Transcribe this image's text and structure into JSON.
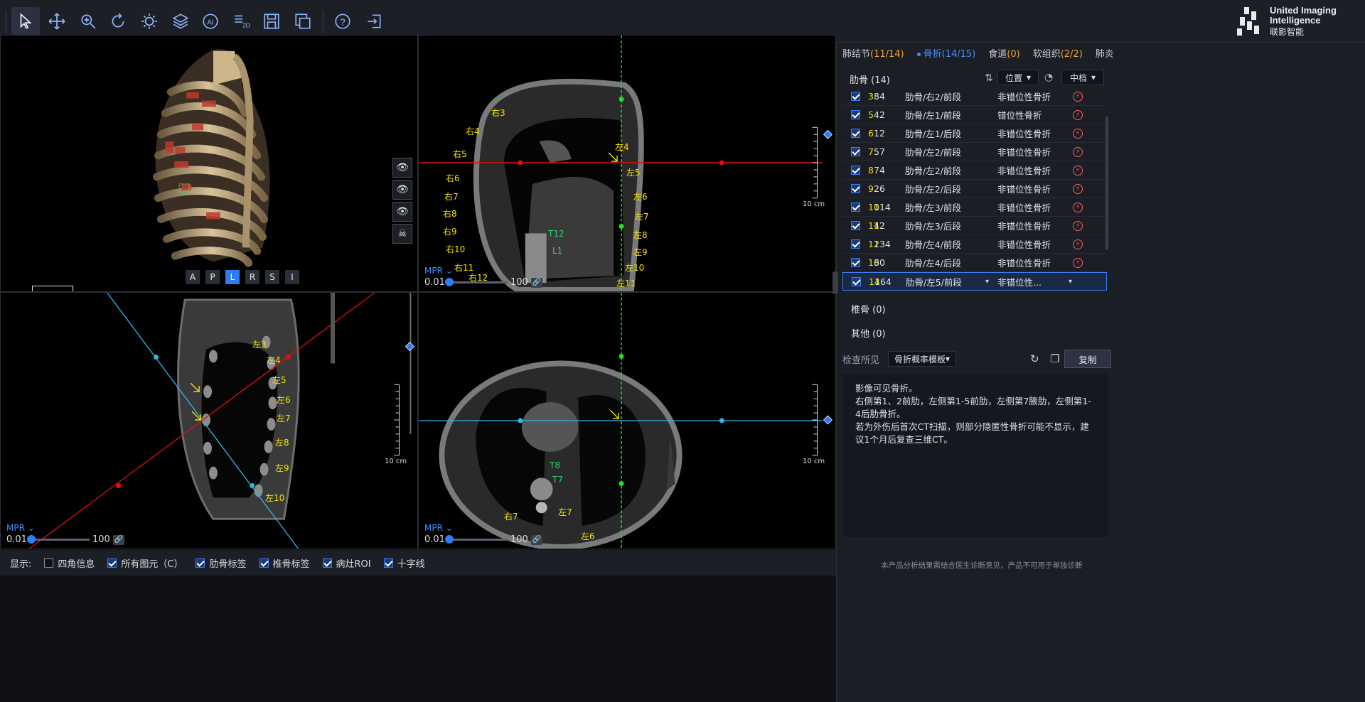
{
  "toolbar": {
    "tools": [
      "select",
      "pan",
      "zoom",
      "rotate",
      "window-level",
      "layers",
      "ai",
      "2d",
      "save",
      "export",
      "help",
      "exit"
    ],
    "brand_en_line1": "United Imaging",
    "brand_en_line2": "Intelligence",
    "brand_cn": "联影智能"
  },
  "viewports": {
    "volume": {
      "orientation_badge": "L",
      "orient_buttons": [
        "A",
        "P",
        "L",
        "R",
        "S",
        "I"
      ],
      "selected_orient": "L"
    },
    "coronal": {
      "mpr_label": "MPR",
      "slider_min": "0.01",
      "slider_max": "100",
      "scale_text": "10 cm",
      "rib_labels": [
        "右3",
        "右4",
        "右5",
        "右6",
        "右7",
        "右8",
        "右9",
        "右10",
        "右11",
        "右12",
        "左4",
        "左5",
        "左6",
        "左7",
        "左8",
        "左9",
        "左10",
        "左11"
      ],
      "vert_labels": [
        "T12",
        "L1"
      ]
    },
    "sagittal": {
      "mpr_label": "MPR",
      "slider_min": "0.01",
      "slider_max": "100",
      "scale_text": "10 cm",
      "rib_labels": [
        "左3",
        "左4",
        "左5",
        "左6",
        "左7",
        "左8",
        "左9",
        "左10"
      ]
    },
    "axial": {
      "mpr_label": "MPR",
      "slider_min": "0.01",
      "slider_max": "100",
      "scale_text": "10 cm",
      "rib_labels": [
        "右7",
        "左7",
        "左6"
      ],
      "vert_labels": [
        "T8",
        "T7"
      ]
    }
  },
  "displaybar": {
    "label": "显示:",
    "options": [
      {
        "label": "四角信息",
        "checked": false
      },
      {
        "label": "所有图元（C）",
        "checked": true
      },
      {
        "label": "肋骨标签",
        "checked": true
      },
      {
        "label": "椎骨标签",
        "checked": true
      },
      {
        "label": "病灶ROI",
        "checked": true
      },
      {
        "label": "十字线",
        "checked": true
      }
    ]
  },
  "panel": {
    "tabs": [
      {
        "label": "肺结节",
        "count": "(11/14)",
        "active": false
      },
      {
        "label": "骨折",
        "count": "(14/15)",
        "active": true
      },
      {
        "label": "食道",
        "count": "(0)",
        "active": false
      },
      {
        "label": "软组织",
        "count": "(2/2)",
        "active": false
      },
      {
        "label": "肺炎",
        "count": "",
        "active": false
      }
    ],
    "rib_header": "肋骨 (14)",
    "sort_dropdown": "位置",
    "level_dropdown": "中档",
    "rows": [
      {
        "no": "3",
        "val": "84",
        "name": "肋骨/右2/前段",
        "type": "非错位性骨折"
      },
      {
        "no": "5",
        "val": "42",
        "name": "肋骨/左1/前段",
        "type": "错位性骨折"
      },
      {
        "no": "6",
        "val": "12",
        "name": "肋骨/左1/后段",
        "type": "非错位性骨折"
      },
      {
        "no": "7",
        "val": "57",
        "name": "肋骨/左2/前段",
        "type": "非错位性骨折"
      },
      {
        "no": "8",
        "val": "74",
        "name": "肋骨/左2/前段",
        "type": "非错位性骨折"
      },
      {
        "no": "9",
        "val": "26",
        "name": "肋骨/左2/后段",
        "type": "非错位性骨折"
      },
      {
        "no": "10",
        "val": "114",
        "name": "肋骨/左3/前段",
        "type": "非错位性骨折"
      },
      {
        "no": "11",
        "val": "42",
        "name": "肋骨/左3/后段",
        "type": "非错位性骨折"
      },
      {
        "no": "12",
        "val": "134",
        "name": "肋骨/左4/前段",
        "type": "非错位性骨折"
      },
      {
        "no": "13",
        "val": "60",
        "name": "肋骨/左4/后段",
        "type": "非错位性骨折"
      },
      {
        "no": "14",
        "val": "164",
        "name": "肋骨/左5/前段",
        "type": "非错位性..."
      }
    ],
    "vertebra_header": "椎骨 (0)",
    "other_header": "其他 (0)",
    "findings_label": "检查所见",
    "template_dropdown": "骨折概率模板",
    "copy_button": "复制",
    "report_lines": [
      "影像可见骨折。",
      "右侧第1、2前肋，左侧第1-5前肋，左侧第7腋肋，左侧第1-4后肋骨折。",
      "若为外伤后首次CT扫描，则部分隐匿性骨折可能不显示，建议1个月后复查三维CT。"
    ],
    "footer_note": "本产品分析结果需结合医生诊断意见，产品不可用于单独诊断"
  },
  "colors": {
    "accent": "#2f7cf6",
    "rib_label": "#f5e200",
    "vert_label": "#2fd16b",
    "crosshair_green": "#22e022",
    "crosshair_red": "#e01010",
    "crosshair_cyan": "#2bb8e8"
  }
}
